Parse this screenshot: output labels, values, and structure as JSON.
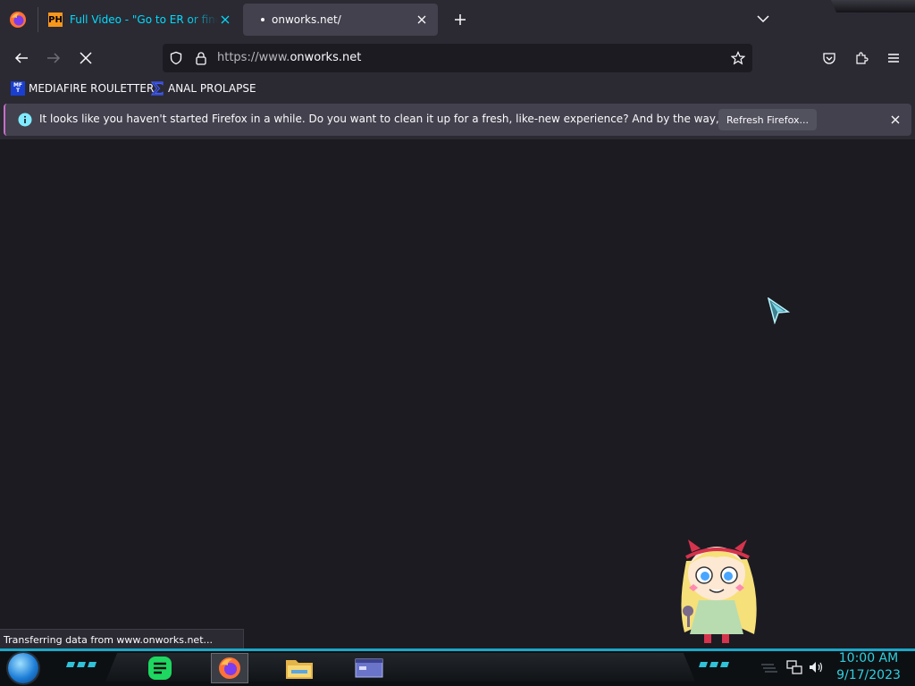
{
  "browser": {
    "tabs": [
      {
        "favicon": "PH",
        "title": "Full Video - \"Go to ER or find so",
        "active": false
      },
      {
        "title": "onworks.net/",
        "active": true,
        "loading": true
      }
    ],
    "urlbar": {
      "scheme": "https://www.",
      "domain": "onworks.net"
    },
    "bookmarks": [
      {
        "icon_text": "MF T",
        "label": "MEDIAFIRE ROULETTER"
      },
      {
        "icon": "sigma-icon",
        "label": "ANAL PROLAPSE"
      }
    ],
    "notification": {
      "text": "It looks like you haven't started Firefox in a while. Do you want to clean it up for a fresh, like-new experience? And by the way, welcome back!",
      "button": "Refresh Firefox..."
    },
    "status_text": "Transferring data from www.onworks.net..."
  },
  "taskbar": {
    "apps": [
      "notes-app-icon",
      "firefox-icon",
      "file-explorer-icon",
      "window-app-icon"
    ],
    "tray": [
      "network-icon",
      "volume-icon"
    ],
    "time": "10:00 AM",
    "date": "9/17/2023"
  },
  "colors": {
    "accent": "#00ddff",
    "clock": "#2fd0e0",
    "taskbar_line": "#1aa8c9",
    "notice_border": "#c86fc9"
  }
}
